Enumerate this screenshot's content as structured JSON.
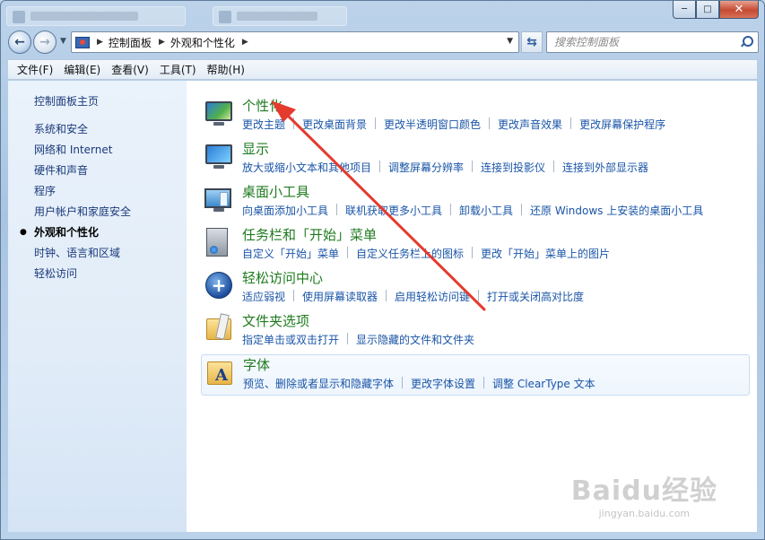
{
  "window": {
    "background_tabs": 2,
    "caption": {
      "minimize": "─",
      "maximize": "□",
      "close": "✕"
    }
  },
  "nav": {
    "back_icon": "back-arrow-icon",
    "forward_icon": "forward-arrow-icon",
    "breadcrumbs": [
      "控制面板",
      "外观和个性化"
    ],
    "refresh_icon": "refresh-icon",
    "search_placeholder": "搜索控制面板"
  },
  "menubar": [
    "文件(F)",
    "编辑(E)",
    "查看(V)",
    "工具(T)",
    "帮助(H)"
  ],
  "sidebar": {
    "home": "控制面板主页",
    "items": [
      {
        "label": "系统和安全",
        "active": false
      },
      {
        "label": "网络和 Internet",
        "active": false
      },
      {
        "label": "硬件和声音",
        "active": false
      },
      {
        "label": "程序",
        "active": false
      },
      {
        "label": "用户帐户和家庭安全",
        "active": false
      },
      {
        "label": "外观和个性化",
        "active": true
      },
      {
        "label": "时钟、语言和区域",
        "active": false
      },
      {
        "label": "轻松访问",
        "active": false
      }
    ]
  },
  "categories": [
    {
      "title": "个性化",
      "icon": "personalization-icon",
      "links": [
        "更改主题",
        "更改桌面背景",
        "更改半透明窗口颜色",
        "更改声音效果",
        "更改屏幕保护程序"
      ]
    },
    {
      "title": "显示",
      "icon": "display-icon",
      "links": [
        "放大或缩小文本和其他项目",
        "调整屏幕分辨率",
        "连接到投影仪",
        "连接到外部显示器"
      ]
    },
    {
      "title": "桌面小工具",
      "icon": "gadgets-icon",
      "links": [
        "向桌面添加小工具",
        "联机获取更多小工具",
        "卸载小工具",
        "还原 Windows 上安装的桌面小工具"
      ]
    },
    {
      "title": "任务栏和「开始」菜单",
      "icon": "taskbar-icon",
      "links": [
        "自定义「开始」菜单",
        "自定义任务栏上的图标",
        "更改「开始」菜单上的图片"
      ]
    },
    {
      "title": "轻松访问中心",
      "icon": "ease-of-access-icon",
      "links": [
        "适应弱视",
        "使用屏幕读取器",
        "启用轻松访问键",
        "打开或关闭高对比度"
      ]
    },
    {
      "title": "文件夹选项",
      "icon": "folder-options-icon",
      "links": [
        "指定单击或双击打开",
        "显示隐藏的文件和文件夹"
      ]
    },
    {
      "title": "字体",
      "icon": "fonts-icon",
      "links": [
        "预览、删除或者显示和隐藏字体",
        "更改字体设置",
        "调整 ClearType 文本"
      ]
    }
  ],
  "colors": {
    "category_title": "#1f7b1f",
    "link": "#1a55a7",
    "sidebar_link": "#1a3a7a",
    "annotation_arrow": "#e53a2e"
  },
  "watermark": {
    "logo": "Baidu经验",
    "url": "jingyan.baidu.com"
  }
}
